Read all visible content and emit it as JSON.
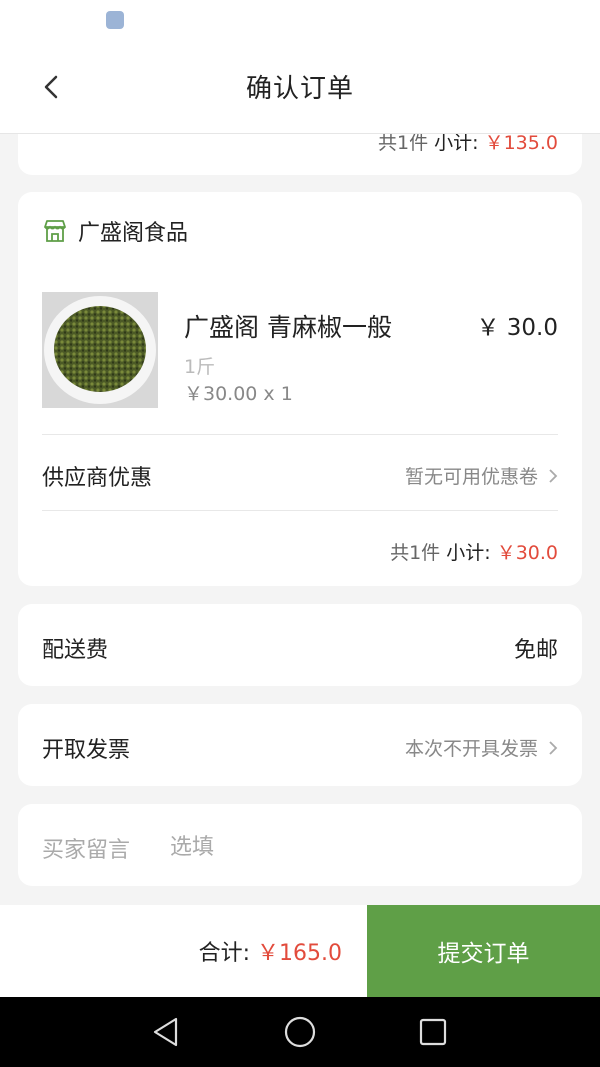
{
  "header": {
    "title": "确认订单"
  },
  "previous_store": {
    "count_label": "共1件",
    "subtotal_label": "小计:",
    "subtotal_value": "￥135.0"
  },
  "store": {
    "name": "广盛阁食品",
    "product": {
      "name": "广盛阁 青麻椒一般",
      "price": "￥ 30.0",
      "spec": "1斤",
      "unit_price_qty": "￥30.00 x 1"
    },
    "supplier_discount": {
      "label": "供应商优惠",
      "value": "暂无可用优惠卷"
    },
    "count_label": "共1件",
    "subtotal_label": "小计:",
    "subtotal_value": "￥30.0"
  },
  "delivery": {
    "label": "配送费",
    "value": "免邮"
  },
  "invoice": {
    "label": "开取发票",
    "value": "本次不开具发票"
  },
  "message": {
    "label": "买家留言",
    "placeholder": "选填"
  },
  "footer": {
    "total_label": "合计:",
    "total_value": "￥165.0",
    "submit_label": "提交订单"
  },
  "colors": {
    "accent_green": "#5f9f47",
    "price_red": "#e24b3c"
  }
}
